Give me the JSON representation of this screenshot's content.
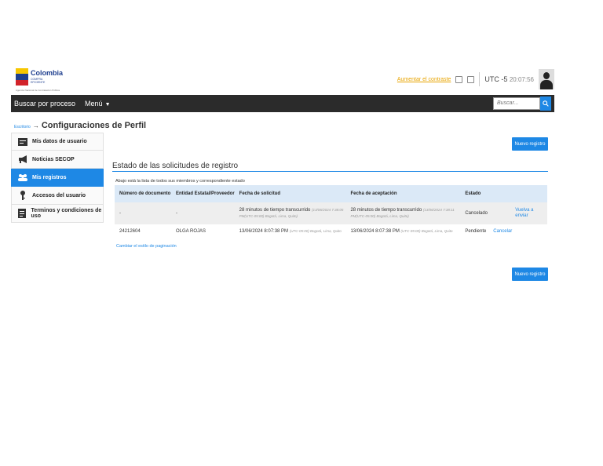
{
  "header": {
    "logo": {
      "name": "Colombia",
      "sub": "COMPRA EFICIENTE",
      "tagline": "Agencia Nacional de Contratación Pública"
    },
    "font_size_link": "Aumentar el contraste",
    "timezone": "UTC -5",
    "time": "20:07:56"
  },
  "nav": {
    "items": [
      "Buscar por proceso",
      "Menú"
    ],
    "search_placeholder": "Buscar..."
  },
  "breadcrumb": {
    "link": "Escritorio",
    "arrow": "→",
    "title": "Configuraciones de Perfil"
  },
  "sidebar": {
    "items": [
      {
        "label": "Mis datos de usuario",
        "icon": "id-card-icon"
      },
      {
        "label": "Noticias SECOP",
        "icon": "megaphone-icon"
      },
      {
        "label": "Mis registros",
        "icon": "users-icon",
        "active": true
      },
      {
        "label": "Accesos del usuario",
        "icon": "key-icon"
      },
      {
        "label": "Terminos y condiciones de uso",
        "icon": "document-icon"
      }
    ]
  },
  "buttons": {
    "new_record_top": "Nuevo registro",
    "new_record_bottom": "Nuevo registro"
  },
  "section": {
    "title": "Estado de las solicitudes de registro",
    "description": "Abajo está la lista de todos sus miembros y correspondiente estado"
  },
  "table": {
    "headers": [
      "Número de documento",
      "Entidad Estatal/Proveedor",
      "Fecha de solicitud",
      "Fecha de aceptación",
      "Estado",
      ""
    ],
    "rows": [
      {
        "doc": "-",
        "entity": "-",
        "request_date": "28 minutos de tiempo transcurrido",
        "request_date_tz": "(13/06/2024 7:38:05 PM(UTC-05:00) Bogotá, Lima, Quito)",
        "accept_date": "28 minutos de tiempo transcurrido",
        "accept_date_tz": "(13/06/2024 7:38:11 PM(UTC-05:00) Bogotá, Lima, Quito)",
        "status": "Cancelado",
        "action": "",
        "action2": "Vuelva a enviar"
      },
      {
        "doc": "24212604",
        "entity": "OLGA ROJAS",
        "request_date": "13/06/2024 8:07:38 PM",
        "request_date_tz": "(UTC-05:00) Bogotá, Lima, Quito",
        "accept_date": "13/06/2024 8:07:38 PM",
        "accept_date_tz": "(UTC-05:00) Bogotá, Lima, Quito",
        "status": "Pendiente",
        "action": "Cancelar",
        "action2": ""
      }
    ]
  },
  "pagination_link": "Cambiar el estilo de paginación",
  "colors": {
    "accent": "#1e88e5",
    "navbar": "#2b2b2b",
    "table_header": "#dbe9f7",
    "link_orange": "#e8a400"
  }
}
